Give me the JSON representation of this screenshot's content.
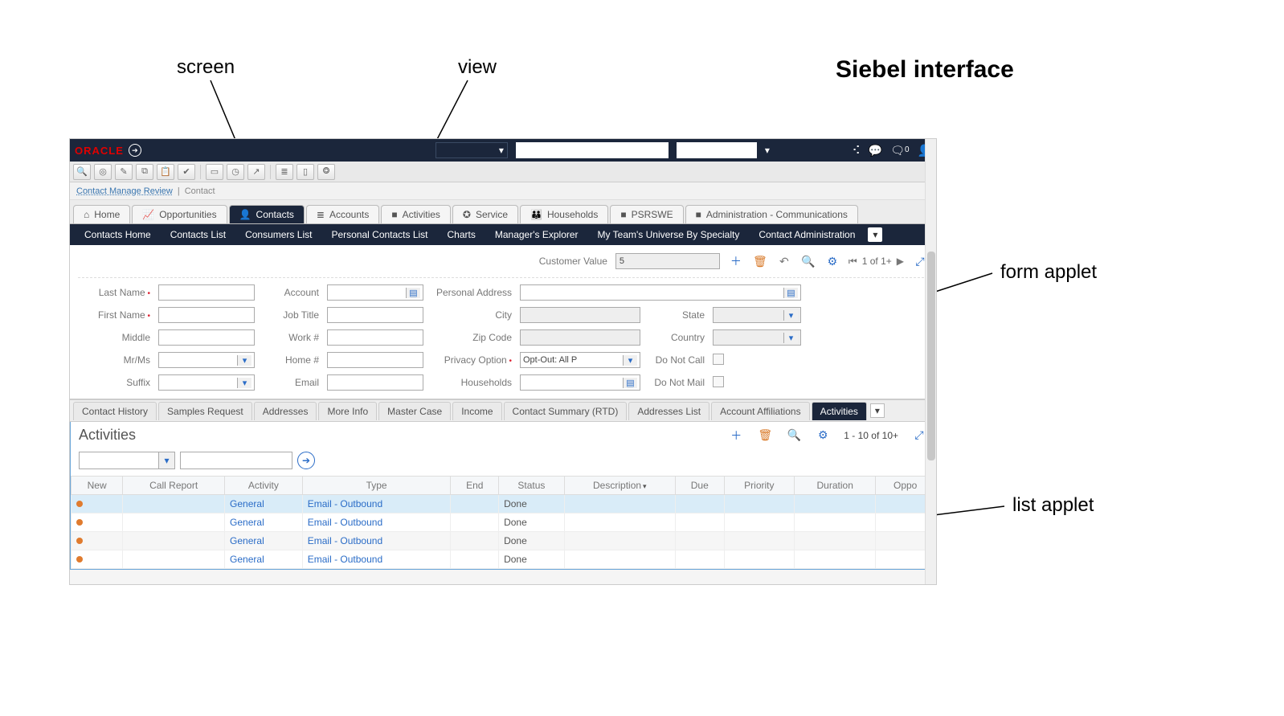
{
  "annotations": {
    "screen": "screen",
    "view": "view",
    "form_applet": "form applet",
    "list_applet": "list applet",
    "title": "Siebel interface"
  },
  "header": {
    "logo": "ORACLE",
    "dropdown_caret": "▾",
    "notifications_count": "0",
    "icons": {
      "share": "share-icon",
      "chat": "chat-icon",
      "bell": "notifications-icon",
      "user": "user-icon"
    }
  },
  "breadcrumb": {
    "a": "Contact Manage Review",
    "sep": "|",
    "b": "Contact"
  },
  "screen_tabs": [
    {
      "label": "Home",
      "icon": "⌂"
    },
    {
      "label": "Opportunities",
      "icon": "📈"
    },
    {
      "label": "Contacts",
      "icon": "👤",
      "active": true
    },
    {
      "label": "Accounts",
      "icon": "≣"
    },
    {
      "label": "Activities",
      "icon": "■"
    },
    {
      "label": "Service",
      "icon": "✪"
    },
    {
      "label": "Households",
      "icon": "👪"
    },
    {
      "label": "PSRSWE",
      "icon": "■"
    },
    {
      "label": "Administration - Communications",
      "icon": "■"
    }
  ],
  "view_tabs": [
    "Contacts Home",
    "Contacts List",
    "Consumers List",
    "Personal Contacts List",
    "Charts",
    "Manager's Explorer",
    "My Team's Universe By Specialty",
    "Contact Administration"
  ],
  "form": {
    "customer_value_label": "Customer Value",
    "customer_value": "5",
    "pager": "1 of 1+",
    "fields": {
      "last_name": "Last Name",
      "first_name": "First Name",
      "middle": "Middle",
      "mrms": "Mr/Ms",
      "suffix": "Suffix",
      "account": "Account",
      "job_title": "Job Title",
      "work": "Work #",
      "home": "Home #",
      "email": "Email",
      "personal_address": "Personal Address",
      "city": "City",
      "zip": "Zip Code",
      "privacy": "Privacy Option",
      "households": "Households",
      "state": "State",
      "country": "Country",
      "do_not_call": "Do Not Call",
      "do_not_mail": "Do Not Mail"
    },
    "privacy_value": "Opt-Out: All P"
  },
  "applet_tabs": [
    "Contact History",
    "Samples Request",
    "Addresses",
    "More Info",
    "Master Case",
    "Income",
    "Contact Summary (RTD)",
    "Addresses List",
    "Account Affiliations",
    "Activities"
  ],
  "applet_active": "Activities",
  "list": {
    "title": "Activities",
    "pager": "1 - 10 of 10+",
    "columns": [
      "New",
      "Call Report",
      "Activity",
      "Type",
      "End",
      "Status",
      "Description",
      "Due",
      "Priority",
      "Duration",
      "Oppo"
    ],
    "sort_col": "Description",
    "rows": [
      {
        "new": true,
        "activity": "General",
        "type": "Email - Outbound",
        "status": "Done",
        "selected": true
      },
      {
        "new": true,
        "activity": "General",
        "type": "Email - Outbound",
        "status": "Done"
      },
      {
        "new": true,
        "activity": "General",
        "type": "Email - Outbound",
        "status": "Done",
        "alt": true
      },
      {
        "new": true,
        "activity": "General",
        "type": "Email - Outbound",
        "status": "Done"
      }
    ]
  }
}
